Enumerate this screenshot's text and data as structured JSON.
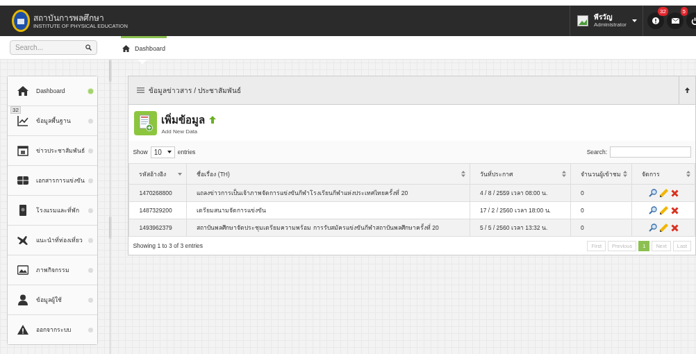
{
  "header": {
    "org_name": "สถาบันการพลศึกษา",
    "org_subtitle": "INSTITUTE OF PHYSICAL EDUCATION",
    "user_name": "พีรวัญ",
    "user_role": "Administrator",
    "notifications": [
      {
        "kind": "alert",
        "count": "32"
      },
      {
        "kind": "mail",
        "count": "5"
      },
      {
        "kind": "power"
      }
    ]
  },
  "search": {
    "placeholder": "Search..."
  },
  "breadcrumb": "Dashboard",
  "sidebar": {
    "items": [
      {
        "label": "Dashboard",
        "selected": true
      },
      {
        "label": "ข้อมูลพื้นฐาน",
        "selected": false,
        "badge": "32"
      },
      {
        "label": "ข่าวประชาสัมพันธ์",
        "selected": false
      },
      {
        "label": "เอกสารการแข่งขัน",
        "selected": false
      },
      {
        "label": "โรงแรมและที่พัก",
        "selected": false
      },
      {
        "label": "แนะนำที่ท่องเที่ยว",
        "selected": false
      },
      {
        "label": "ภาพกิจกรรม",
        "selected": false
      },
      {
        "label": "ข้อมูลผู้ใช้",
        "selected": false
      },
      {
        "label": "ออกจากระบบ",
        "selected": false
      }
    ]
  },
  "panel": {
    "title": "ข้อมูลข่าวสาร / ประชาสัมพันธ์",
    "add_title": "เพิ่มข้อมูล",
    "add_subtitle": "Add New Data",
    "show_label": "Show",
    "page_size": "10",
    "entries_label": "entries",
    "search_label": "Search:",
    "table": {
      "columns": [
        {
          "label": "รหัสอ้างอิง",
          "sorted": true
        },
        {
          "label": "ชื่อเรื่อง (TH)",
          "sorted": false
        },
        {
          "label": "วันที่ประกาศ",
          "sorted": false
        },
        {
          "label": "จำนวนผู้เข้าชม",
          "sorted": false
        },
        {
          "label": "จัดการ",
          "sorted": false
        }
      ],
      "rows": [
        {
          "ref": "1470268800",
          "title": "แถลงข่าวการเป็นเจ้าภาพจัดการแข่งขันกีฬาโรงเรียนกีฬาแห่งประเทศไทยครั้งที่ 20",
          "date": "4 / 8 / 2559 เวลา 08:00 น.",
          "views": "0"
        },
        {
          "ref": "1487329200",
          "title": "เตรียมสนามจัดการแข่งขัน",
          "date": "17 / 2 / 2560 เวลา 18:00 น.",
          "views": "0"
        },
        {
          "ref": "1493962379",
          "title": "สถาบันพลศึกษาจัดประชุมเตรียมความพร้อม การรับสมัครแข่งขันกีฬาสถาบันพลศึกษาครั้งที่ 20",
          "date": "5 / 5 / 2560 เวลา 13:32 น.",
          "views": "0"
        }
      ]
    },
    "info": "Showing 1 to 3 of 3 entries",
    "pagination": [
      {
        "label": "First",
        "selected": false,
        "disabled": true
      },
      {
        "label": "Previous",
        "selected": false,
        "disabled": true
      },
      {
        "label": "1",
        "selected": true,
        "disabled": false
      },
      {
        "label": "Next",
        "selected": false,
        "disabled": true
      },
      {
        "label": "Last",
        "selected": false,
        "disabled": true
      }
    ]
  }
}
